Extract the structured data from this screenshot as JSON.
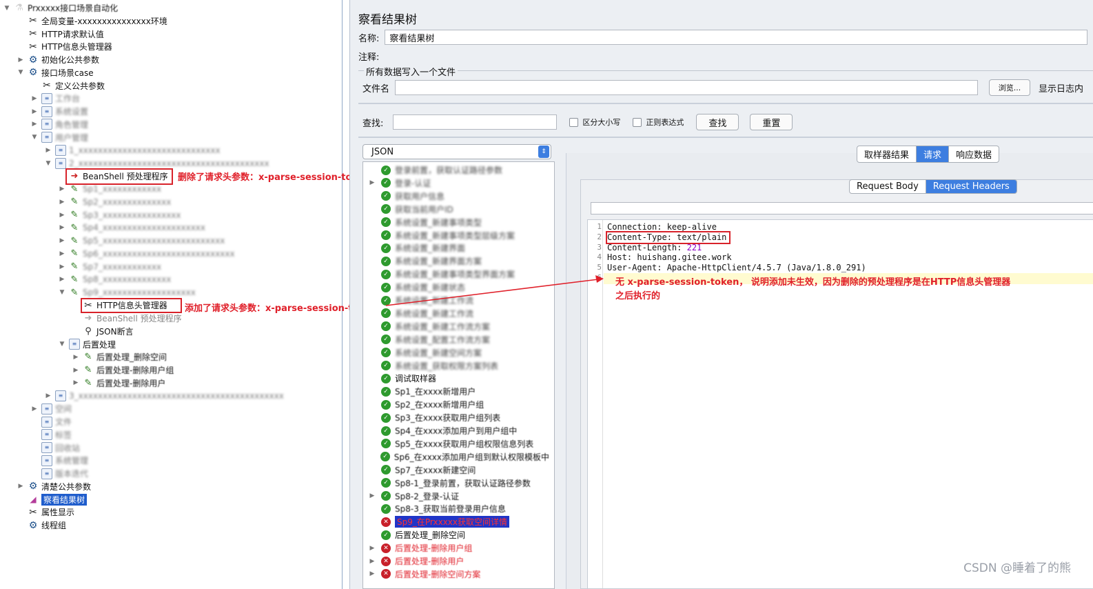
{
  "tree": {
    "items": [
      {
        "label": "Prxxxxx接口场景自动化",
        "indent": 0,
        "twisty": "▼",
        "icon": "beaker-icon",
        "style": "blur-part"
      },
      {
        "label": "全局变量-xxxxxxxxxxxxxxx环境",
        "indent": 1,
        "twisty": "",
        "icon": "wrench-icon",
        "style": "normal"
      },
      {
        "label": "HTTP请求默认值",
        "indent": 1,
        "twisty": "",
        "icon": "wrench-icon",
        "style": "normal"
      },
      {
        "label": "HTTP信息头管理器",
        "indent": 1,
        "twisty": "",
        "icon": "wrench-icon",
        "style": "normal"
      },
      {
        "label": "初始化公共参数",
        "indent": 1,
        "twisty": "▶",
        "icon": "gear-icon",
        "style": "normal"
      },
      {
        "label": "接口场景case",
        "indent": 1,
        "twisty": "▼",
        "icon": "gear-icon",
        "style": "normal"
      },
      {
        "label": "定义公共参数",
        "indent": 2,
        "twisty": "",
        "icon": "wrench-icon",
        "style": "normal"
      },
      {
        "label": "工作台",
        "indent": 2,
        "twisty": "▶",
        "icon": "script-icon",
        "style": "blur"
      },
      {
        "label": "系统设置",
        "indent": 2,
        "twisty": "▶",
        "icon": "script-icon",
        "style": "blur"
      },
      {
        "label": "角色管理",
        "indent": 2,
        "twisty": "▶",
        "icon": "script-icon",
        "style": "blur"
      },
      {
        "label": "用户管理",
        "indent": 2,
        "twisty": "▼",
        "icon": "script-icon",
        "style": "blur"
      },
      {
        "label": "1_xxxxxxxxxxxxxxxxxxxxxxxxxxxxx",
        "indent": 3,
        "twisty": "▶",
        "icon": "script-icon",
        "style": "blur"
      },
      {
        "label": "2_xxxxxxxxxxxxxxxxxxxxxxxxxxxxxxxxxxxxxxx",
        "indent": 3,
        "twisty": "▼",
        "icon": "script-icon",
        "style": "blur"
      },
      {
        "label": "BeanShell 预处理程序",
        "indent": 4,
        "twisty": "",
        "icon": "arrow-icon",
        "style": "normal"
      },
      {
        "label": "Sp1_xxxxxxxxxxxx",
        "indent": 4,
        "twisty": "▶",
        "icon": "pencil-icon",
        "style": "blur"
      },
      {
        "label": "Sp2_xxxxxxxxxxxxxx",
        "indent": 4,
        "twisty": "▶",
        "icon": "pencil-icon",
        "style": "blur"
      },
      {
        "label": "Sp3_xxxxxxxxxxxxxxxx",
        "indent": 4,
        "twisty": "▶",
        "icon": "pencil-icon",
        "style": "blur"
      },
      {
        "label": "Sp4_xxxxxxxxxxxxxxxxxxxxx",
        "indent": 4,
        "twisty": "▶",
        "icon": "pencil-icon",
        "style": "blur"
      },
      {
        "label": "Sp5_xxxxxxxxxxxxxxxxxxxxxxxxx",
        "indent": 4,
        "twisty": "▶",
        "icon": "pencil-icon",
        "style": "blur"
      },
      {
        "label": "Sp6_xxxxxxxxxxxxxxxxxxxxxxxxxxx",
        "indent": 4,
        "twisty": "▶",
        "icon": "pencil-icon",
        "style": "blur"
      },
      {
        "label": "Sp7_xxxxxxxxxxxx",
        "indent": 4,
        "twisty": "▶",
        "icon": "pencil-icon",
        "style": "blur"
      },
      {
        "label": "Sp8_xxxxxxxxxxxxxx",
        "indent": 4,
        "twisty": "▶",
        "icon": "pencil-icon",
        "style": "blur"
      },
      {
        "label": "Sp9_xxxxxxxxxxxxxxxxxxx",
        "indent": 4,
        "twisty": "▼",
        "icon": "pencil-icon",
        "style": "blur"
      },
      {
        "label": "HTTP信息头管理器",
        "indent": 5,
        "twisty": "",
        "icon": "wrench-icon",
        "style": "normal"
      },
      {
        "label": "BeanShell 预处理程序",
        "indent": 5,
        "twisty": "",
        "icon": "arrow-icon",
        "style": "dim"
      },
      {
        "label": "JSON断言",
        "indent": 5,
        "twisty": "",
        "icon": "magnifier-icon",
        "style": "normal"
      },
      {
        "label": "后置处理",
        "indent": 4,
        "twisty": "▼",
        "icon": "script-icon",
        "style": "normal"
      },
      {
        "label": "后置处理_删除空间",
        "indent": 5,
        "twisty": "▶",
        "icon": "pencil-icon",
        "style": "blur-part"
      },
      {
        "label": "后置处理-删除用户组",
        "indent": 5,
        "twisty": "▶",
        "icon": "pencil-icon",
        "style": "blur-part"
      },
      {
        "label": "后置处理-删除用户",
        "indent": 5,
        "twisty": "▶",
        "icon": "pencil-icon",
        "style": "blur-part"
      },
      {
        "label": "3_xxxxxxxxxxxxxxxxxxxxxxxxxxxxxxxxxxxxxxxxxx",
        "indent": 3,
        "twisty": "▶",
        "icon": "script-icon",
        "style": "blur"
      },
      {
        "label": "空间",
        "indent": 2,
        "twisty": "▶",
        "icon": "script-icon",
        "style": "blur"
      },
      {
        "label": "文件",
        "indent": 2,
        "twisty": "",
        "icon": "script-icon",
        "style": "blur"
      },
      {
        "label": "标签",
        "indent": 2,
        "twisty": "",
        "icon": "script-icon",
        "style": "blur"
      },
      {
        "label": "回收站",
        "indent": 2,
        "twisty": "",
        "icon": "script-icon",
        "style": "blur"
      },
      {
        "label": "系统管理",
        "indent": 2,
        "twisty": "",
        "icon": "script-icon",
        "style": "blur"
      },
      {
        "label": "版本迭代",
        "indent": 2,
        "twisty": "",
        "icon": "script-icon",
        "style": "blur"
      },
      {
        "label": "清楚公共参数",
        "indent": 1,
        "twisty": "▶",
        "icon": "gear-icon",
        "style": "normal"
      },
      {
        "label": "察看结果树",
        "indent": 1,
        "twisty": "",
        "icon": "chart-icon",
        "style": "selected"
      },
      {
        "label": "属性显示",
        "indent": 1,
        "twisty": "",
        "icon": "wrench-icon",
        "style": "normal"
      },
      {
        "label": "线程组",
        "indent": 1,
        "twisty": "",
        "icon": "gear-icon",
        "style": "normal"
      }
    ],
    "annotation1": "删除了请求头参数：x-parse-session-token",
    "annotation2": "添加了请求头参数：x-parse-session-token"
  },
  "panel": {
    "title": "察看结果树",
    "name_label": "名称:",
    "name_value": "察看结果树",
    "comment_label": "注释:",
    "file_group_label": "所有数据写入一个文件",
    "file_label": "文件名",
    "browse_button": "浏览...",
    "log_label": "显示日志内",
    "search_label": "查找:",
    "case_label": "区分大小写",
    "regex_label": "正则表达式",
    "find_button": "查找",
    "reset_button": "重置",
    "format_select": "JSON"
  },
  "samplers": [
    {
      "label": "登录前置，获取认证路径参数",
      "status": "ok",
      "arrow": "",
      "style": "blur"
    },
    {
      "label": "登录-认证",
      "status": "ok",
      "arrow": "▶",
      "style": "blur"
    },
    {
      "label": "获取用户信息",
      "status": "ok",
      "arrow": "",
      "style": "blur"
    },
    {
      "label": "获取当前用户ID",
      "status": "ok",
      "arrow": "",
      "style": "blur"
    },
    {
      "label": "系统设置_新建事项类型",
      "status": "ok",
      "arrow": "",
      "style": "blur"
    },
    {
      "label": "系统设置_新建事项类型层级方案",
      "status": "ok",
      "arrow": "",
      "style": "blur"
    },
    {
      "label": "系统设置_新建界面",
      "status": "ok",
      "arrow": "",
      "style": "blur"
    },
    {
      "label": "系统设置_新建界面方案",
      "status": "ok",
      "arrow": "",
      "style": "blur"
    },
    {
      "label": "系统设置_新建事项类型界面方案",
      "status": "ok",
      "arrow": "",
      "style": "blur"
    },
    {
      "label": "系统设置_新建状态",
      "status": "ok",
      "arrow": "",
      "style": "blur"
    },
    {
      "label": "系统设置_新建工作流",
      "status": "ok",
      "arrow": "",
      "style": "blur"
    },
    {
      "label": "系统设置_新建工作流",
      "status": "ok",
      "arrow": "",
      "style": "blur"
    },
    {
      "label": "系统设置_新建工作流方案",
      "status": "ok",
      "arrow": "",
      "style": "blur"
    },
    {
      "label": "系统设置_配置工作流方案",
      "status": "ok",
      "arrow": "",
      "style": "blur"
    },
    {
      "label": "系统设置_新建空间方案",
      "status": "ok",
      "arrow": "",
      "style": "blur"
    },
    {
      "label": "系统设置_获取权限方案列表",
      "status": "ok",
      "arrow": "",
      "style": "blur"
    },
    {
      "label": "调试取样器",
      "status": "ok",
      "arrow": "",
      "style": "normal"
    },
    {
      "label": "Sp1_在xxxx新增用户",
      "status": "ok",
      "arrow": "",
      "style": "blur-part"
    },
    {
      "label": "Sp2_在xxxx新增用户组",
      "status": "ok",
      "arrow": "",
      "style": "blur-part"
    },
    {
      "label": "Sp3_在xxxx获取用户组列表",
      "status": "ok",
      "arrow": "",
      "style": "blur-part"
    },
    {
      "label": "Sp4_在xxxx添加用户到用户组中",
      "status": "ok",
      "arrow": "",
      "style": "blur-part"
    },
    {
      "label": "Sp5_在xxxx获取用户组权限信息列表",
      "status": "ok",
      "arrow": "",
      "style": "blur-part"
    },
    {
      "label": "Sp6_在xxxx添加用户组到默认权限模板中",
      "status": "ok",
      "arrow": "",
      "style": "blur-part"
    },
    {
      "label": "Sp7_在xxxx新建空间",
      "status": "ok",
      "arrow": "",
      "style": "blur-part"
    },
    {
      "label": "Sp8-1_登录前置，获取认证路径参数",
      "status": "ok",
      "arrow": "",
      "style": "blur-part"
    },
    {
      "label": "Sp8-2_登录-认证",
      "status": "ok",
      "arrow": "▶",
      "style": "blur-part"
    },
    {
      "label": "Sp8-3_获取当前登录用户信息",
      "status": "ok",
      "arrow": "",
      "style": "blur-part"
    },
    {
      "label": "Sp9_在Prxxxxx获取空间详情",
      "status": "bad",
      "arrow": "",
      "style": "selected"
    },
    {
      "label": "后置处理_删除空间",
      "status": "ok",
      "arrow": "",
      "style": "normal"
    },
    {
      "label": "后置处理-删除用户组",
      "status": "bad",
      "arrow": "▶",
      "style": "err-blur"
    },
    {
      "label": "后置处理-删除用户",
      "status": "bad",
      "arrow": "▶",
      "style": "err-blur"
    },
    {
      "label": "后置处理-删除空间方案",
      "status": "bad",
      "arrow": "▶",
      "style": "err-blur"
    }
  ],
  "result_tabs": [
    "取样器结果",
    "请求",
    "响应数据"
  ],
  "result_tab_active": 1,
  "request_tabs": [
    "Request Body",
    "Request Headers"
  ],
  "request_tab_active": 1,
  "headers": [
    {
      "n": "1",
      "key": "Connection: ",
      "val": "keep-alive",
      "num": ""
    },
    {
      "n": "2",
      "key": "Content-Type: ",
      "val": "text/plain",
      "num": ""
    },
    {
      "n": "3",
      "key": "Content-Length: ",
      "val": "",
      "num": "221"
    },
    {
      "n": "4",
      "key": "Host: ",
      "val": "huishang.gitee.work",
      "num": ""
    },
    {
      "n": "5",
      "key": "User-Agent: ",
      "val": "Apache-HttpClient/4.5.7 (Java/1.8.0_291)",
      "num": ""
    },
    {
      "n": "6",
      "key": "",
      "val": "",
      "num": ""
    }
  ],
  "note_line1": "无 x-parse-session-token， 说明添加未生效，因为删除的预处理程序是在HTTP信息头管理器",
  "note_line2": "之后执行的",
  "watermark": "CSDN @睡着了的熊",
  "colors": {
    "accent": "#3d7ee0",
    "annotation_red": "#e0202a",
    "selected_tree": "#1f5dcc",
    "ok_shield": "#2e9a2e",
    "bad_shield": "#c8202a"
  }
}
